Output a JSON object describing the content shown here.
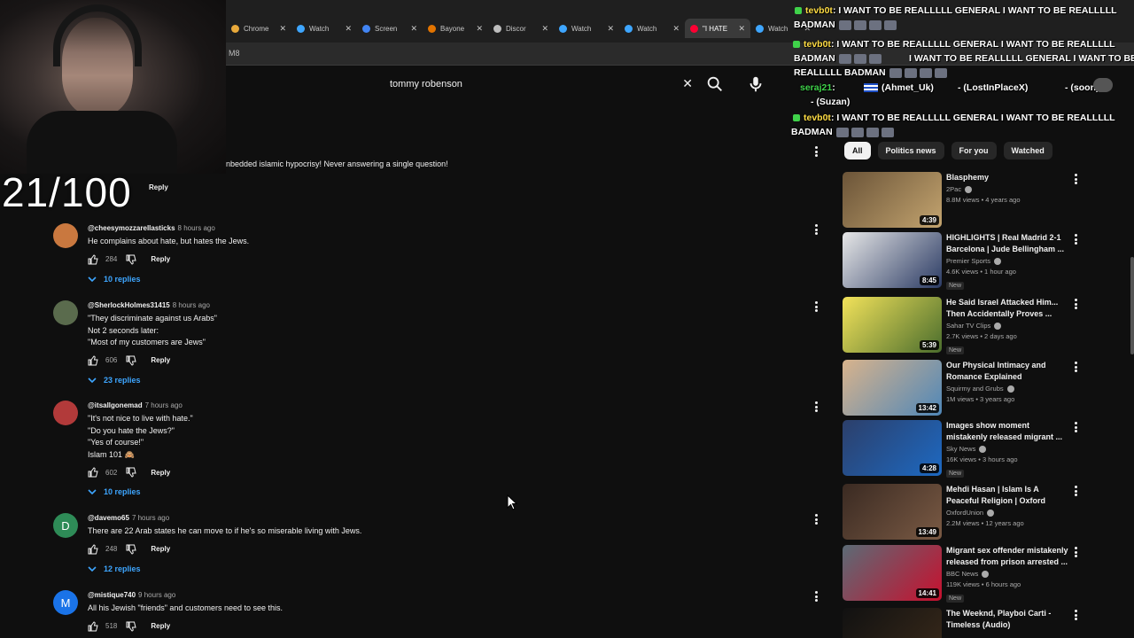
{
  "browser": {
    "tabs": [
      {
        "title": "Chrome",
        "fav": "#e8a93b",
        "active": false
      },
      {
        "title": "Watch",
        "fav": "#3ea6ff",
        "active": false
      },
      {
        "title": "Screen",
        "fav": "#4285f4",
        "active": false
      },
      {
        "title": "Bayone",
        "fav": "#e37400",
        "active": false
      },
      {
        "title": "Discor",
        "fav": "#bdbdbd",
        "active": false
      },
      {
        "title": "Watch",
        "fav": "#3ea6ff",
        "active": false
      },
      {
        "title": "Watch",
        "fav": "#3ea6ff",
        "active": false
      },
      {
        "title": "\"I HATE",
        "fav": "#ff0033",
        "active": true
      },
      {
        "title": "Watch",
        "fav": "#3ea6ff",
        "active": false
      }
    ],
    "url_fragment": "M8"
  },
  "overlay": {
    "counter": "21/100"
  },
  "search": {
    "query": "tommy robenson"
  },
  "partial_comment": {
    "text": "nbedded islamic hypocrisy! Never answering a single question!",
    "reply_label": "Reply",
    "replies_fragment": "s"
  },
  "comments": [
    {
      "author": "@cheesymozzarellasticks",
      "time": "8 hours ago",
      "avatar_letter": "",
      "avatar_color": "#c9783f",
      "lines": [
        "He complains about hate, but hates the Jews."
      ],
      "likes": "284",
      "reply": "Reply",
      "replies": "10 replies"
    },
    {
      "author": "@SherlockHolmes31415",
      "time": "8 hours ago",
      "avatar_letter": "",
      "avatar_color": "#5a6b4d",
      "lines": [
        "\"They discriminate against us Arabs\"",
        "Not 2 seconds later:",
        "\"Most of my customers are Jews\""
      ],
      "likes": "606",
      "reply": "Reply",
      "replies": "23 replies"
    },
    {
      "author": "@itsallgonemad",
      "time": "7 hours ago",
      "avatar_letter": "",
      "avatar_color": "#b23a3a",
      "lines": [
        "\"It's not nice to live with hate.\"",
        "\"Do you hate the Jews?\"",
        "\"Yes of course!\"",
        "Islam 101 🙈"
      ],
      "likes": "602",
      "reply": "Reply",
      "replies": "10 replies"
    },
    {
      "author": "@davemo65",
      "time": "7 hours ago",
      "avatar_letter": "D",
      "avatar_color": "#2e8b57",
      "lines": [
        "There are 22 Arab states he can move to if he's so miserable living with Jews."
      ],
      "likes": "248",
      "reply": "Reply",
      "replies": "12 replies"
    },
    {
      "author": "@mistique740",
      "time": "9 hours ago",
      "avatar_letter": "M",
      "avatar_color": "#1a73e8",
      "lines": [
        "All his Jewish \"friends\" and customers need to see this."
      ],
      "likes": "518",
      "reply": "Reply",
      "replies": ""
    }
  ],
  "chat": [
    {
      "user": "tevb0t",
      "text": ": I WANT TO BE REALLLLL GENERAL I WANT TO BE REALLLLL"
    },
    {
      "user": "",
      "text": "BADMAN"
    },
    {
      "user": "tevb0t",
      "text": ": I WANT TO BE REALLLLL GENERAL I WANT TO BE REALLLLL"
    },
    {
      "user": "",
      "text": "BADMAN"
    },
    {
      "user": "",
      "text": "I WANT TO BE REALLLLL GENERAL I WANT TO BE"
    },
    {
      "user": "",
      "text": "REALLLLL BADMAN"
    },
    {
      "user": "seraj21",
      "text": ":"
    },
    {
      "user": "",
      "text": "(Ahmet_Uk)"
    },
    {
      "user": "",
      "text": "- (LostInPlaceX)"
    },
    {
      "user": "",
      "text": "- (soon)"
    },
    {
      "user": "",
      "text": "- (Suzan)"
    },
    {
      "user": "tevb0t",
      "text": ": I WANT TO BE REALLLLL GENERAL I WANT TO BE REALLLLL"
    },
    {
      "user": "",
      "text": "BADMAN"
    }
  ],
  "chips": [
    "All",
    "Politics news",
    "For you",
    "Watched"
  ],
  "videos": [
    {
      "title": "Blasphemy",
      "channel": "2Pac",
      "meta": "8.8M views • 4 years ago",
      "duration": "4:39",
      "is_new": false,
      "thumb_colors": [
        "#6b5438",
        "#c3a46f"
      ]
    },
    {
      "title": "HIGHLIGHTS | Real Madrid 2-1 Barcelona | Jude Bellingham ...",
      "channel": "Premier Sports",
      "meta": "4.6K views • 1 hour ago",
      "duration": "8:45",
      "is_new": true,
      "thumb_colors": [
        "#e7e7e7",
        "#2b3b64"
      ]
    },
    {
      "title": "He Said Israel Attacked Him... Then Accidentally Proves ...",
      "channel": "Sahar TV Clips",
      "meta": "2.7K views • 2 days ago",
      "duration": "5:39",
      "is_new": true,
      "thumb_colors": [
        "#f2e25a",
        "#4a6d2d"
      ]
    },
    {
      "title": "Our Physical Intimacy and Romance Explained",
      "channel": "Squirmy and Grubs",
      "meta": "1M views • 3 years ago",
      "duration": "13:42",
      "is_new": false,
      "thumb_colors": [
        "#d8b38c",
        "#4f87b8"
      ]
    },
    {
      "title": "Images show moment mistakenly released migrant ...",
      "channel": "Sky News",
      "meta": "16K views • 3 hours ago",
      "duration": "4:28",
      "is_new": true,
      "thumb_colors": [
        "#2c3f6a",
        "#1d69c2"
      ]
    },
    {
      "title": "Mehdi Hasan | Islam Is A Peaceful Religion | Oxford Union",
      "channel": "OxfordUnion",
      "meta": "2.2M views • 12 years ago",
      "duration": "13:49",
      "is_new": false,
      "thumb_colors": [
        "#3a2a22",
        "#7a5a44"
      ]
    },
    {
      "title": "Migrant sex offender mistakenly released from prison arrested ...",
      "channel": "BBC News",
      "meta": "119K views • 6 hours ago",
      "duration": "14:41",
      "is_new": true,
      "thumb_colors": [
        "#5b6b76",
        "#c8102e"
      ]
    },
    {
      "title": "The Weeknd, Playboi Carti - Timeless (Audio)",
      "channel": "",
      "meta": "",
      "duration": "",
      "is_new": false,
      "thumb_colors": [
        "#111111",
        "#3a2a1a"
      ]
    }
  ]
}
